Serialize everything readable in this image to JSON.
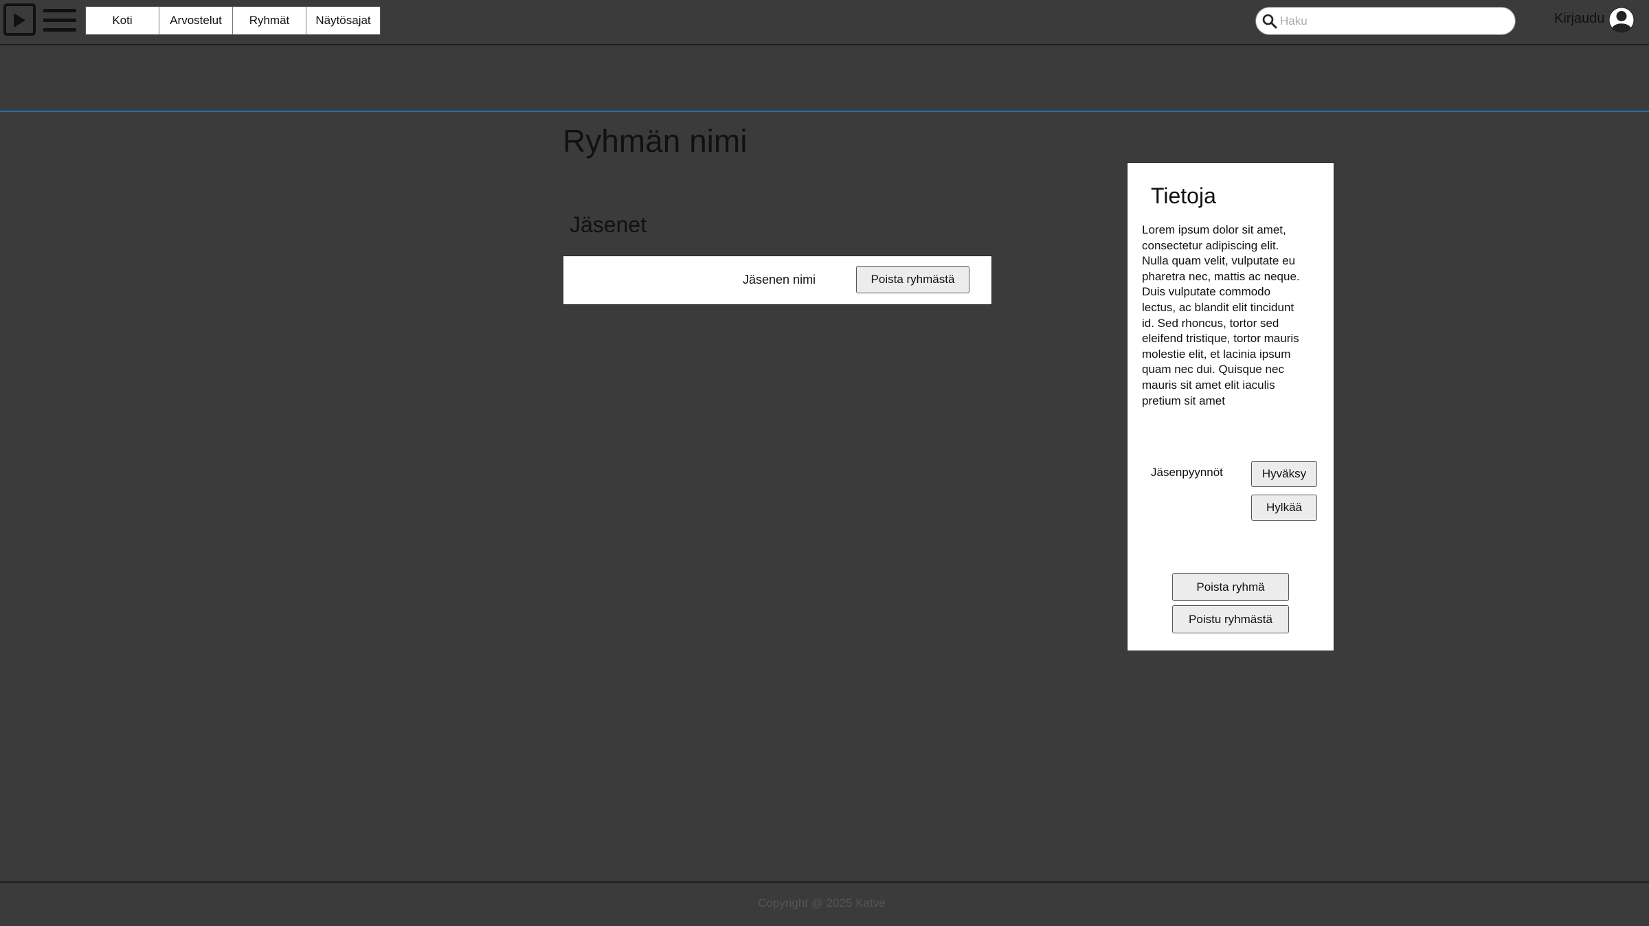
{
  "header": {
    "logo_icon": "play-icon",
    "menu_icon": "hamburger-menu-icon",
    "nav_tabs": [
      "Koti",
      "Arvostelut",
      "Ryhmät",
      "Näytösajat"
    ],
    "search": {
      "placeholder": "Haku",
      "value": "",
      "icon": "search-icon"
    },
    "login_label": "Kirjaudu",
    "avatar_icon": "user-avatar-icon"
  },
  "main": {
    "title": "Ryhmän nimi",
    "members_heading": "Jäsenet",
    "members": [
      {
        "name": "Jäsenen nimi",
        "remove_label": "Poista ryhmästä"
      }
    ]
  },
  "info_panel": {
    "title": "Tietoja",
    "description": "Lorem ipsum dolor sit amet, consectetur adipiscing elit. Nulla quam velit, vulputate eu pharetra nec, mattis ac neque. Duis vulputate commodo lectus, ac blandit elit tincidunt id. Sed rhoncus, tortor sed eleifend tristique, tortor mauris molestie elit, et lacinia ipsum quam nec dui. Quisque nec mauris sit amet elit iaculis pretium sit amet",
    "requests_label": "Jäsenpyynnöt",
    "accept_label": "Hyväksy",
    "reject_label": "Hylkää",
    "delete_group_label": "Poista ryhmä",
    "leave_group_label": "Poistu ryhmästä"
  },
  "footer": {
    "copyright": "Copyright @ 2025 Katve"
  },
  "colors": {
    "background": "#3b3b3b",
    "accent_line": "#2d6ea8",
    "panel": "#ffffff"
  }
}
